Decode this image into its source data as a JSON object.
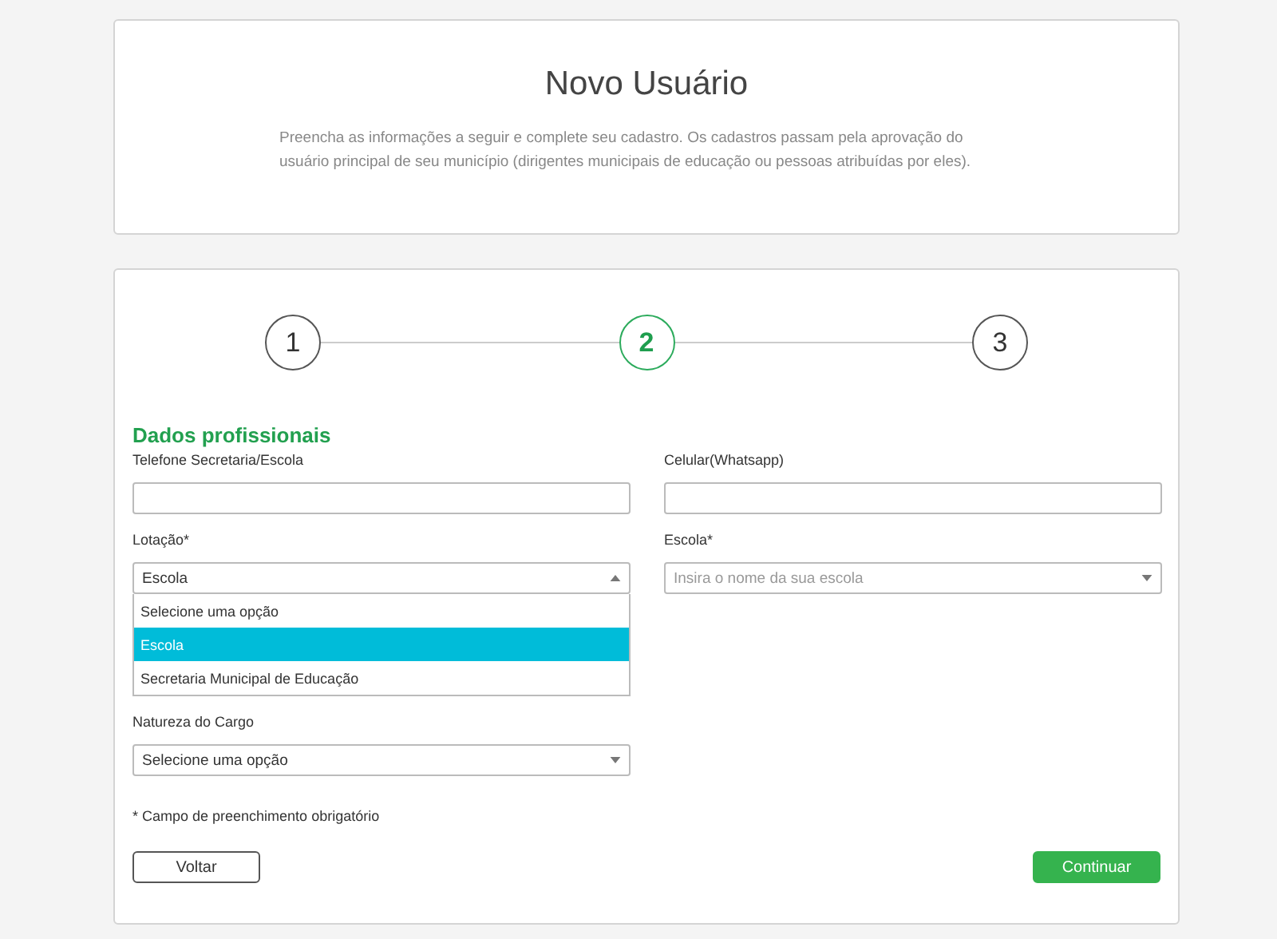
{
  "header": {
    "title": "Novo Usuário",
    "description": "Preencha as informações a seguir e complete seu cadastro. Os cadastros passam pela aprovação do usuário principal de seu município (dirigentes municipais de educação ou pessoas atribuídas por eles)."
  },
  "steps": [
    {
      "label": "1",
      "selected": false
    },
    {
      "label": "2",
      "selected": true
    },
    {
      "label": "3",
      "selected": false
    }
  ],
  "section_title": "Dados profissionais",
  "fields": [
    {
      "label": "Telefone Secretaria/Escola",
      "kind": "text"
    },
    {
      "label": "Celular(Whatsapp)",
      "kind": "text"
    },
    {
      "label": "Lotação*",
      "kind": "select",
      "value": "Escola",
      "expanded": true,
      "options": [
        {
          "label": "Selecione uma opção",
          "selected": false
        },
        {
          "label": "Escola",
          "selected": true
        },
        {
          "label": "Secretaria Municipal de Educação",
          "selected": false
        }
      ]
    },
    {
      "label": "Escola*",
      "kind": "select",
      "placeholder": "Insira o nome da sua escola",
      "expanded": false
    },
    {
      "label": "Natureza do Cargo",
      "kind": "select",
      "value": "Selecione uma opção",
      "expanded": false
    }
  ],
  "footnote": "* Campo de preenchimento obrigatório",
  "buttons": [
    {
      "label": "Voltar",
      "kind": "secondary"
    },
    {
      "label": "Continuar",
      "kind": "primary"
    }
  ]
}
